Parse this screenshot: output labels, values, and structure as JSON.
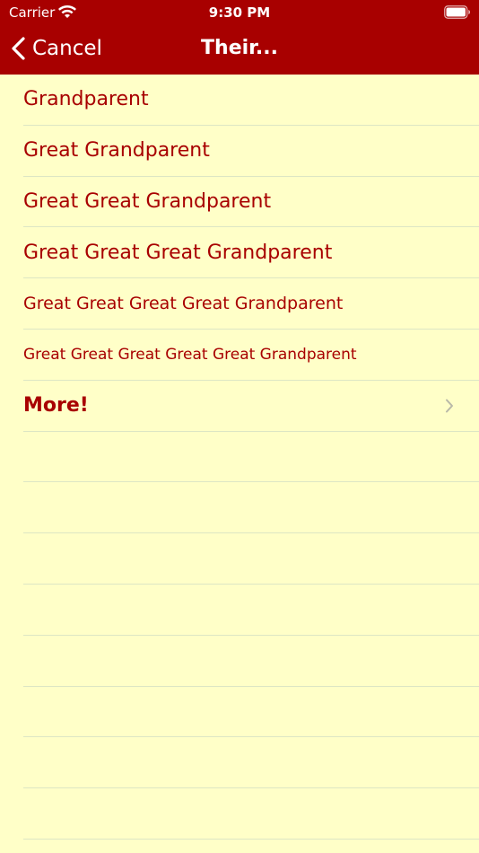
{
  "status_bar": {
    "carrier": "Carrier",
    "time": "9:30 PM"
  },
  "nav": {
    "back_label": "Cancel",
    "title": "Their..."
  },
  "rows": [
    {
      "label": "Grandparent"
    },
    {
      "label": "Great Grandparent"
    },
    {
      "label": "Great Great Grandparent"
    },
    {
      "label": "Great Great Great Grandparent"
    },
    {
      "label": "Great Great Great Great Grandparent"
    },
    {
      "label": "Great Great Great Great Great Grandparent"
    }
  ],
  "more": {
    "label": "More!"
  },
  "colors": {
    "header_bg": "#A80000",
    "page_bg": "#FFFFC8",
    "text": "#A80000",
    "separator": "#DDE6C4"
  },
  "icons": [
    "wifi-icon",
    "battery-icon",
    "back-chevron-icon",
    "disclosure-chevron-icon"
  ]
}
